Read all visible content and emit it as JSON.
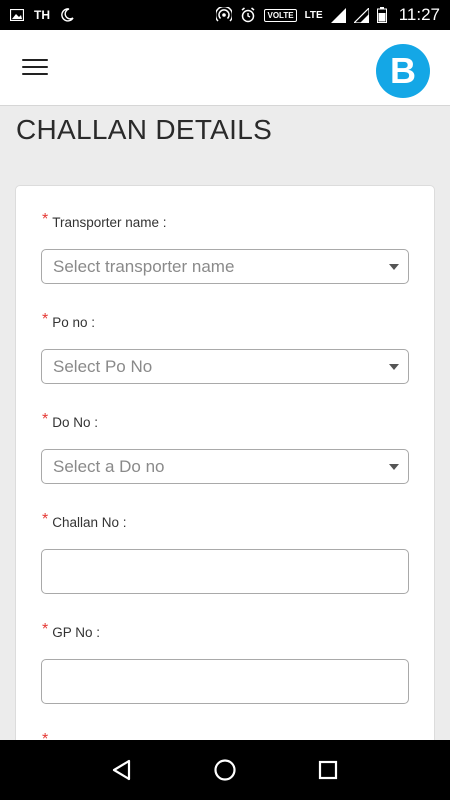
{
  "status_bar": {
    "carrier_short": "TH",
    "volte_label": "VOLTE",
    "network_label": "LTE",
    "time": "11:27"
  },
  "header": {
    "logo_letter": "B",
    "logo_color": "#14a7e6"
  },
  "page": {
    "title": "CHALLAN DETAILS"
  },
  "form": {
    "required_mark": "*",
    "fields": [
      {
        "label": "Transporter name :",
        "type": "select",
        "placeholder": "Select transporter name"
      },
      {
        "label": "Po no :",
        "type": "select",
        "placeholder": "Select Po No"
      },
      {
        "label": "Do No :",
        "type": "select",
        "placeholder": "Select a Do no"
      },
      {
        "label": "Challan No :",
        "type": "text",
        "value": ""
      },
      {
        "label": "GP No :",
        "type": "text",
        "value": ""
      }
    ]
  },
  "icons": {
    "menu": "hamburger-menu-icon",
    "back": "back-triangle-icon",
    "home": "home-circle-icon",
    "recents": "recents-square-icon"
  },
  "colors": {
    "required": "#e53935",
    "background": "#ececec"
  }
}
